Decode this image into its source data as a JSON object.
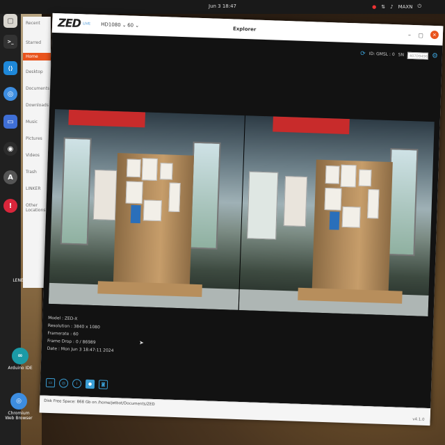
{
  "topbar": {
    "clock": "Jun 3  18:47",
    "tray_user": "MAXN"
  },
  "dock": {
    "apps": [
      {
        "name": "files",
        "glyph": "▢",
        "color": "#d9d6cf"
      },
      {
        "name": "terminal",
        "glyph": ">_",
        "color": "#333333"
      },
      {
        "name": "vscode",
        "glyph": "⟨⟩",
        "color": "#1e88d9"
      },
      {
        "name": "chromium",
        "glyph": "◎",
        "color": "#3d8de0"
      },
      {
        "name": "notes",
        "glyph": "▭",
        "color": "#3f6fd6"
      },
      {
        "name": "obs",
        "glyph": "◉",
        "color": "#2c2c2c"
      },
      {
        "name": "software",
        "glyph": "A",
        "color": "#555555"
      },
      {
        "name": "alert",
        "glyph": "!",
        "color": "#d9263b"
      }
    ]
  },
  "files_sidebar": {
    "header": "Recent",
    "items": [
      "Starred",
      "Home",
      "Desktop",
      "Documents",
      "Downloads",
      "Music",
      "Pictures",
      "Videos",
      "Trash",
      "LINKER",
      "Other Locations"
    ]
  },
  "desktop_icons": [
    {
      "label": "LENEW",
      "glyph": ""
    },
    {
      "label": "Arduino IDE",
      "glyph": "∞",
      "color": "#1b9aa6"
    },
    {
      "label": "Chromium Web Browser",
      "glyph": "◎",
      "color": "#3d8de0"
    }
  ],
  "window": {
    "logo": "ZED",
    "live": "LIVE",
    "resolution": "HD1080",
    "fps": "60",
    "title": "Explorer",
    "close": "×"
  },
  "toolbar": {
    "camera": "ID: GMSL : 0",
    "sn_label": "SN",
    "sn_value": "407D9496"
  },
  "info": {
    "model": "Model : ZED-X",
    "resolution": "Resolution : 3840 x 1080",
    "framerate": "Framerate : 60",
    "frame_drop": "Frame Drop : 0 / 86989",
    "date": "Date : Mon Jun 3 18:47:11 2024"
  },
  "status": {
    "path": "Disk Free Space: 868 Gb  on  /home/jetbot/Documents/ZED",
    "version": "v4.1.0"
  }
}
